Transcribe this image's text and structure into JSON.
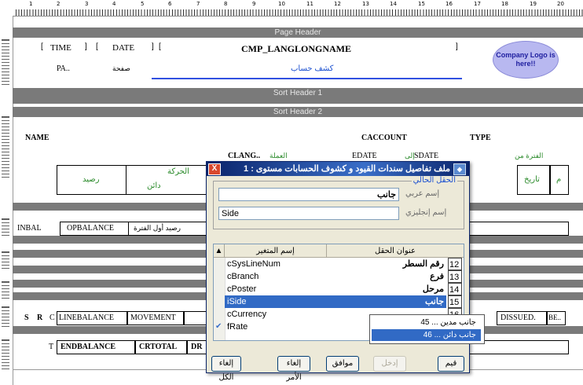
{
  "ruler": {
    "numbers": [
      "1",
      "2",
      "3",
      "4",
      "5",
      "6",
      "7",
      "8",
      "9",
      "10",
      "11",
      "12",
      "13",
      "14",
      "15",
      "16",
      "17",
      "18",
      "19",
      "20"
    ]
  },
  "bands": {
    "page_header": "Page Header",
    "sort_header_1": "Sort Header 1",
    "sort_header_2": "Sort Header 2"
  },
  "report": {
    "time": "TIME",
    "date": "DATE",
    "page": "PA..",
    "page_ar": "صفحة",
    "company": "CMP_LANGLONGNAME",
    "title_ar": "كشف حساب",
    "logo": "Company Logo is here!!",
    "name": "NAME",
    "caccount": "CACCOUNT",
    "type": "TYPE",
    "clang": "CLANG..",
    "currency_ar": "العملة",
    "edate": "EDATE",
    "to_ar": "إلى",
    "sdate": "SDATE",
    "period_from_ar": "الفترة من",
    "balance_ar": "رصيد",
    "movement_ar": "الحركة",
    "debit_ar": "دائن",
    "date_ar": "تاريخ",
    "m_ar": "م",
    "tinbal": "INBAL",
    "opbalance": "OPBALANCE",
    "op_ar": "رصيد أول الفترة",
    "s": "S",
    "r": "R",
    "c": "C",
    "linebalance": "LINEBALANCE",
    "movement": "MOVEMENT",
    "dissued": "DISSUED.",
    "be": "BE..",
    "t": "T",
    "endbalance": "ENDBALANCE",
    "crtotal": "CRTOTAL",
    "dr": "DR"
  },
  "dialog": {
    "title": "ملف تفاصيل سندات القيود و كشوف الحسابات مستوى : 1",
    "close": "X",
    "group_label": "الحقل الحالي",
    "arabic_name_label": "إسم عربي",
    "arabic_name_value": "جانب",
    "english_name_label": "إسم إنجليزي",
    "english_name_value": "Side",
    "columns": {
      "var": "إسم المتغير",
      "title": "عنوان الحقل"
    },
    "rows": [
      {
        "num": "12",
        "title": "رقم السطر",
        "var": "cSysLineNum"
      },
      {
        "num": "13",
        "title": "فرع",
        "var": "cBranch"
      },
      {
        "num": "14",
        "title": "مرحل",
        "var": "cPoster"
      },
      {
        "num": "15",
        "title": "جانب",
        "var": "iSide"
      },
      {
        "num": "16",
        "title": "",
        "var": "cCurrency"
      },
      {
        "num": "17",
        "title": "",
        "var": "fRate"
      }
    ],
    "dropdown": [
      "جانب مدين ... 45",
      "جانب دائن ... 46"
    ],
    "buttons": {
      "cancel_all": "إلغاء الكل",
      "cancel_cmd": "إلغاء الأمر",
      "ok": "موافق",
      "add": "إدخل",
      "value": "قيم"
    }
  },
  "colors": {
    "band": "#7a7a7a",
    "title_bar": "#0a246a",
    "selection": "#316ac5",
    "green_text": "#2a8a2a",
    "blue_text": "#1a4fd0"
  }
}
